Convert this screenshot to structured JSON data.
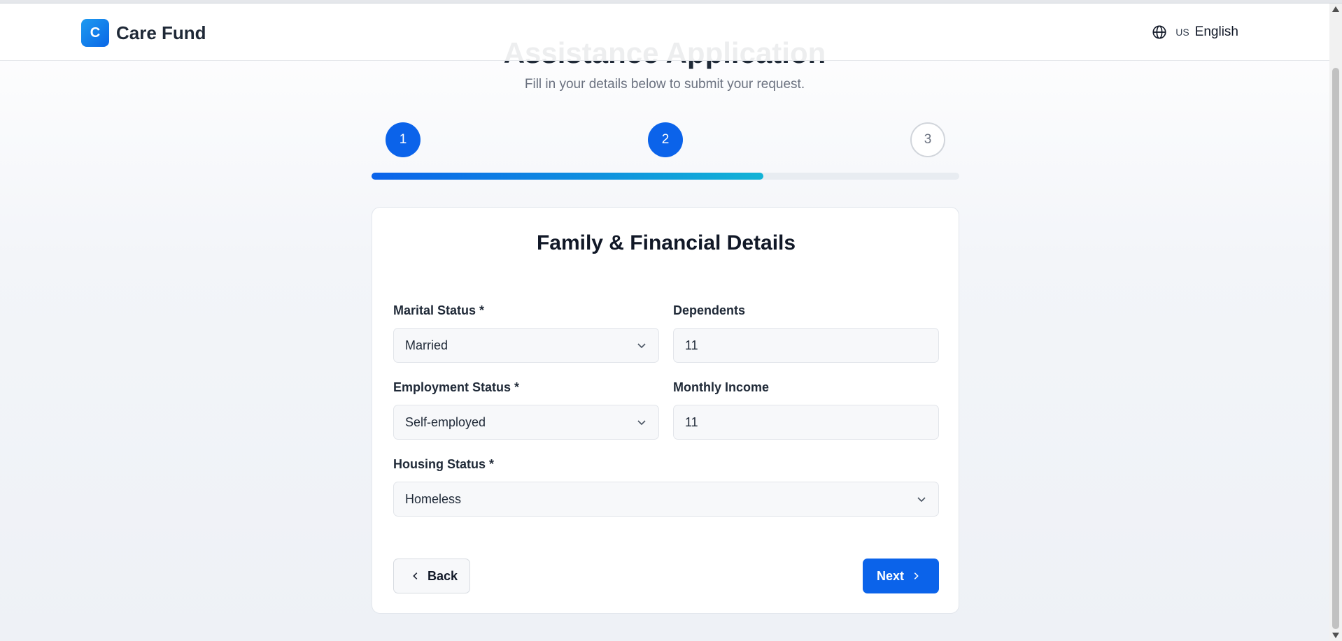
{
  "header": {
    "logo_letter": "C",
    "brand_name": "Care Fund",
    "language_flag": "US",
    "language": "English"
  },
  "page": {
    "title": "Assistance Application",
    "subtitle": "Fill in your details below to submit your request."
  },
  "steps": {
    "items": [
      {
        "number": "1",
        "state": "complete"
      },
      {
        "number": "2",
        "state": "current"
      },
      {
        "number": "3",
        "state": "pending"
      }
    ],
    "progress_percent": 66.7
  },
  "form": {
    "title": "Family & Financial Details",
    "marital_status": {
      "label": "Marital Status *",
      "value": "Married"
    },
    "dependents": {
      "label": "Dependents",
      "value": "11"
    },
    "employment_status": {
      "label": "Employment Status *",
      "value": "Self-employed"
    },
    "monthly_income": {
      "label": "Monthly Income",
      "value": "11"
    },
    "housing_status": {
      "label": "Housing Status *",
      "value": "Homeless"
    }
  },
  "buttons": {
    "back": "Back",
    "next": "Next"
  },
  "colors": {
    "primary": "#0b63ea",
    "progress_end": "#12b3d6",
    "text": "#111827",
    "muted": "#6b7280"
  }
}
